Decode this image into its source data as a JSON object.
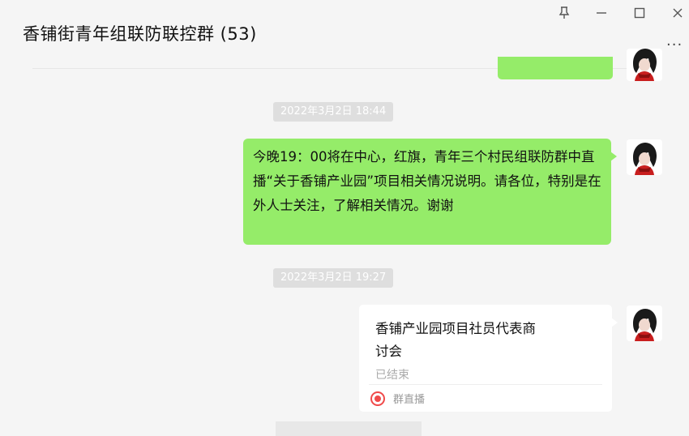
{
  "window": {
    "title": "香铺街青年组联防联控群 (53)",
    "controls": {
      "pin": "⇡",
      "minimize": "—",
      "maximize": "□",
      "close": "✕"
    },
    "more": "..."
  },
  "messages": [
    {
      "type": "timestamp",
      "text": "2022年3月2日 18:44"
    },
    {
      "type": "text",
      "sender": "self",
      "text": "今晚19：00将在中心，红旗，青年三个村民组联防群中直播“关于香铺产业园”项目相关情况说明。请各位，特别是在外人士关注，了解相关情况。谢谢"
    },
    {
      "type": "timestamp",
      "text": "2022年3月2日 19:27"
    },
    {
      "type": "live-card",
      "sender": "self",
      "title": "香铺产业园项目社员代表商讨会",
      "status": "已结束",
      "footer_label": "群直播"
    }
  ],
  "icons": {
    "avatar": "avatar-icon",
    "live": "live-stream-icon"
  },
  "colors": {
    "self_bubble": "#95ec69",
    "background": "#f5f5f5",
    "live_red": "#f04a4a"
  }
}
